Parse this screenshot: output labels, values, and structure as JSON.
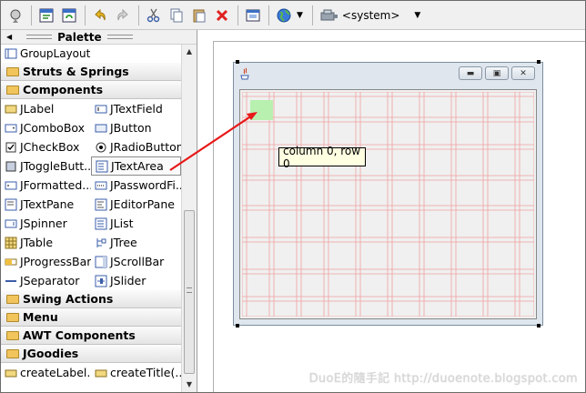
{
  "palette": {
    "title": "Palette",
    "partial_top": "GroupLayout",
    "categories_top": [
      "Struts & Springs",
      "Components"
    ],
    "components": [
      [
        "JLabel",
        "JTextField"
      ],
      [
        "JComboBox",
        "JButton"
      ],
      [
        "JCheckBox",
        "JRadioButton"
      ],
      [
        "JToggleButt...",
        "JTextArea"
      ],
      [
        "JFormatted...",
        "JPasswordFi..."
      ],
      [
        "JTextPane",
        "JEditorPane"
      ],
      [
        "JSpinner",
        "JList"
      ],
      [
        "JTable",
        "JTree"
      ],
      [
        "JProgressBar",
        "JScrollBar"
      ],
      [
        "JSeparator",
        "JSlider"
      ]
    ],
    "categories_bottom": [
      "Swing Actions",
      "Menu",
      "AWT Components",
      "JGoodies"
    ],
    "partial_bottom": [
      "createLabel...",
      "createTitle(..."
    ]
  },
  "toolbar": {
    "system_label": "<system>"
  },
  "designer": {
    "tooltip": "column 0, row 0"
  },
  "watermark": "DuoE的隨手記 http://duoenote.blogspot.com",
  "colors": {
    "grid_line": "#f0a0a0",
    "highlight_cell": "#b8f0b0",
    "arrow": "#e81818",
    "tooltip_bg": "#ffffe1"
  }
}
